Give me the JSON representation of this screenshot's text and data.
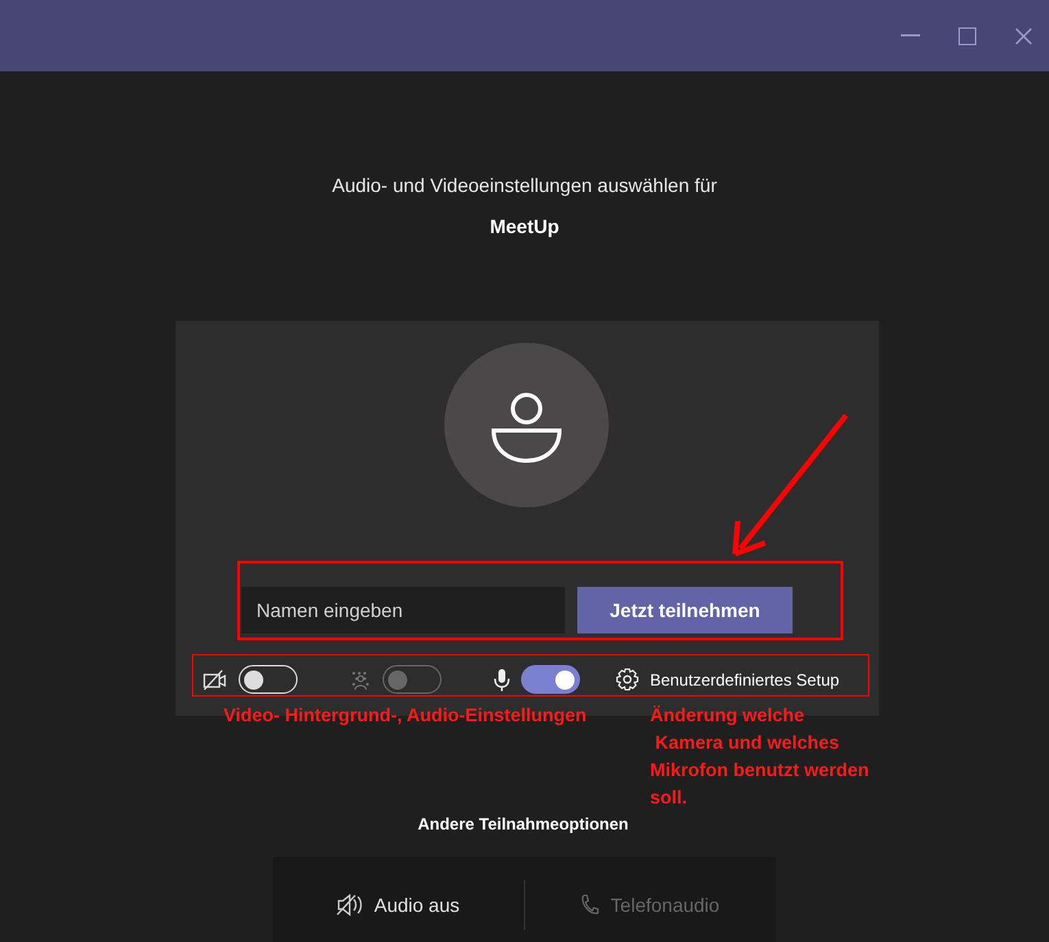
{
  "heading": "Audio- und Videoeinstellungen auswählen für",
  "meeting": "MeetUp",
  "name_field": {
    "placeholder": "Namen eingeben"
  },
  "join_button": "Jetzt teilnehmen",
  "toggles": [
    {
      "kind": "camera",
      "on": false,
      "disabled": false
    },
    {
      "kind": "background",
      "on": false,
      "disabled": true
    },
    {
      "kind": "mic",
      "on": true,
      "disabled": false
    }
  ],
  "setup_link": "Benutzerdefiniertes Setup",
  "other_options": "Andere Teilnahmeoptionen",
  "options": [
    {
      "kind": "audio_off",
      "label": "Audio aus",
      "disabled": false
    },
    {
      "kind": "phone",
      "label": "Telefonaudio",
      "disabled": true
    }
  ],
  "annotations": [
    "Video- Hintergrund-, Audio-Einstellungen",
    "Änderung welche\n Kamera und welches\nMikrofon benutzt werden\nsoll."
  ]
}
